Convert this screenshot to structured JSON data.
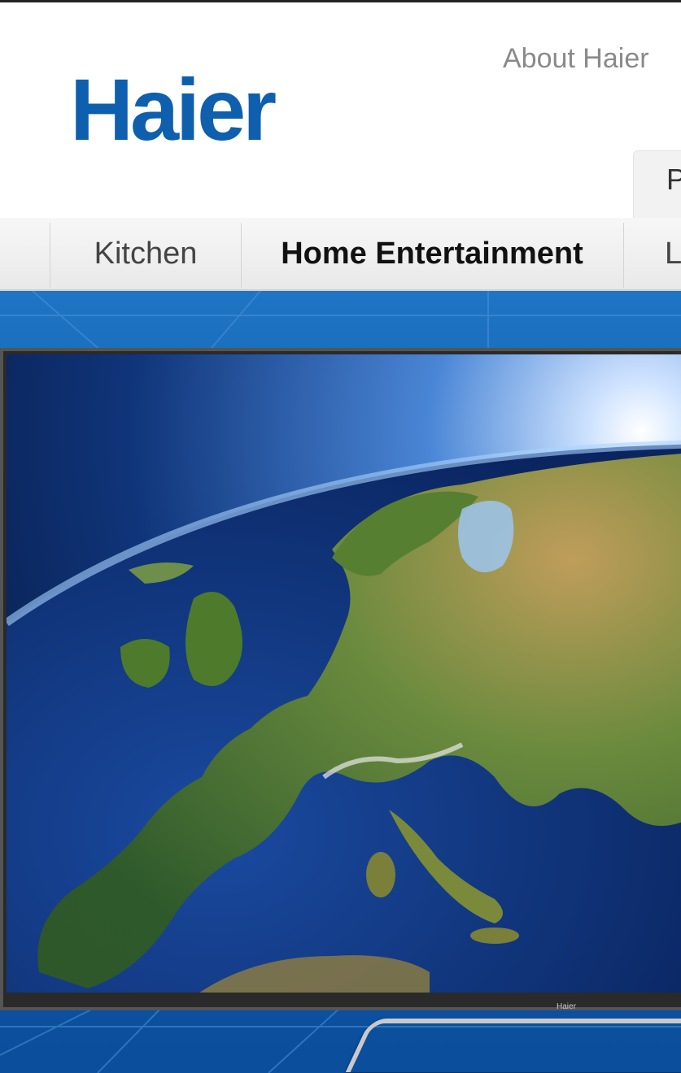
{
  "header": {
    "logo_text": "Haier",
    "about_link": "About Haier",
    "partial_tab": "P"
  },
  "nav": {
    "items": [
      {
        "label": "Kitchen"
      },
      {
        "label": "Home Entertainment",
        "active": true
      },
      {
        "label": "L"
      }
    ]
  },
  "hero": {
    "tv_brand": "Haier"
  },
  "colors": {
    "brand_blue": "#0e5fae",
    "hero_blue": "#1565b8"
  }
}
